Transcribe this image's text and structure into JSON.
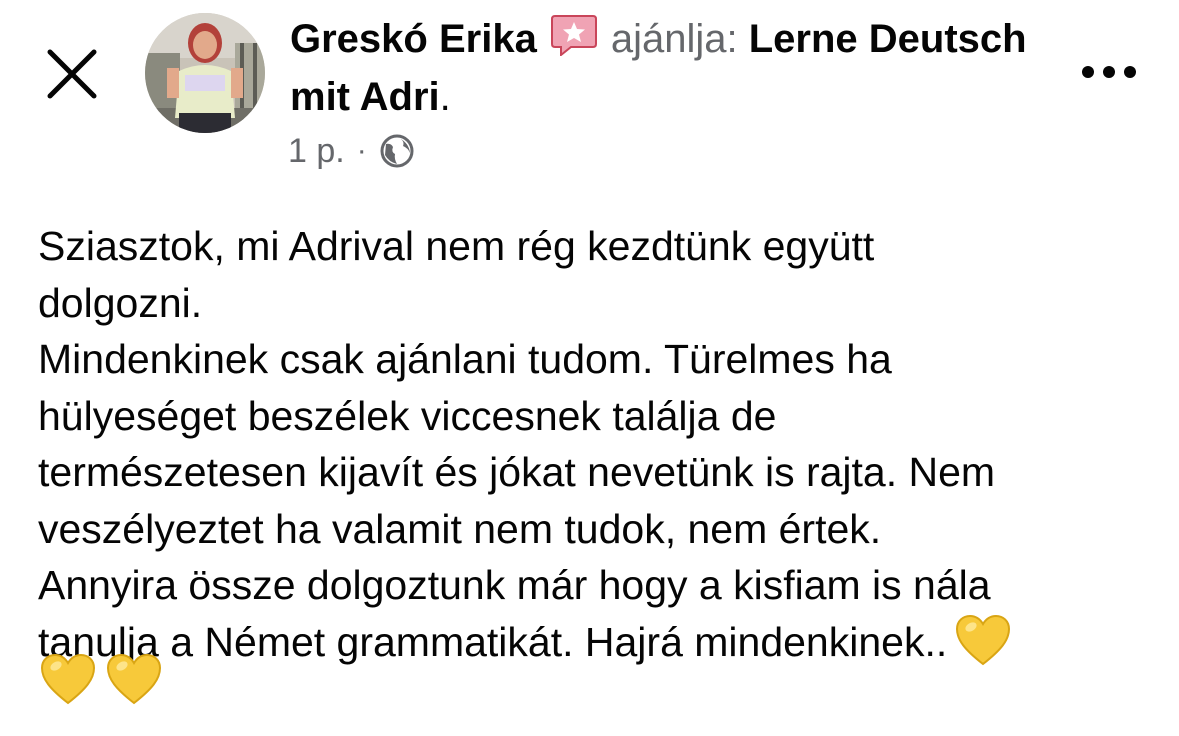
{
  "post": {
    "author_name": "Greskó Erika",
    "action_text": "ajánlja:",
    "page_name": "Lerne Deutsch mit Adri",
    "after_page": ".",
    "time": "1 p.",
    "separator": "·",
    "privacy_icon": "globe-icon",
    "body_text": "Sziasztok, mi Adrival nem rég kezdtünk együtt\ndolgozni.\nMindenkinek csak ajánlani tudom. Türelmes ha\nhülyeséget beszélek viccesnek találja de\ntermészetesen kijavít és jókat nevetünk is rajta. Nem\nveszélyeztet ha valamit nem tudok, nem értek.\nAnnyira össze dolgoztunk már hogy a kisfiam is nála\ntanulja a Német grammatikát. Hajrá mindenkinek..",
    "emojis": [
      "yellow-heart-emoji",
      "yellow-heart-emoji",
      "yellow-heart-emoji"
    ]
  },
  "header": {
    "close_icon": "close-icon",
    "more_icon": "more-icon",
    "recommend_icon": "recommendation-star-icon"
  },
  "colors": {
    "text": "#050505",
    "secondary": "#65676b",
    "recommend": "#f0a3b4",
    "heart": "#f7c93a"
  }
}
